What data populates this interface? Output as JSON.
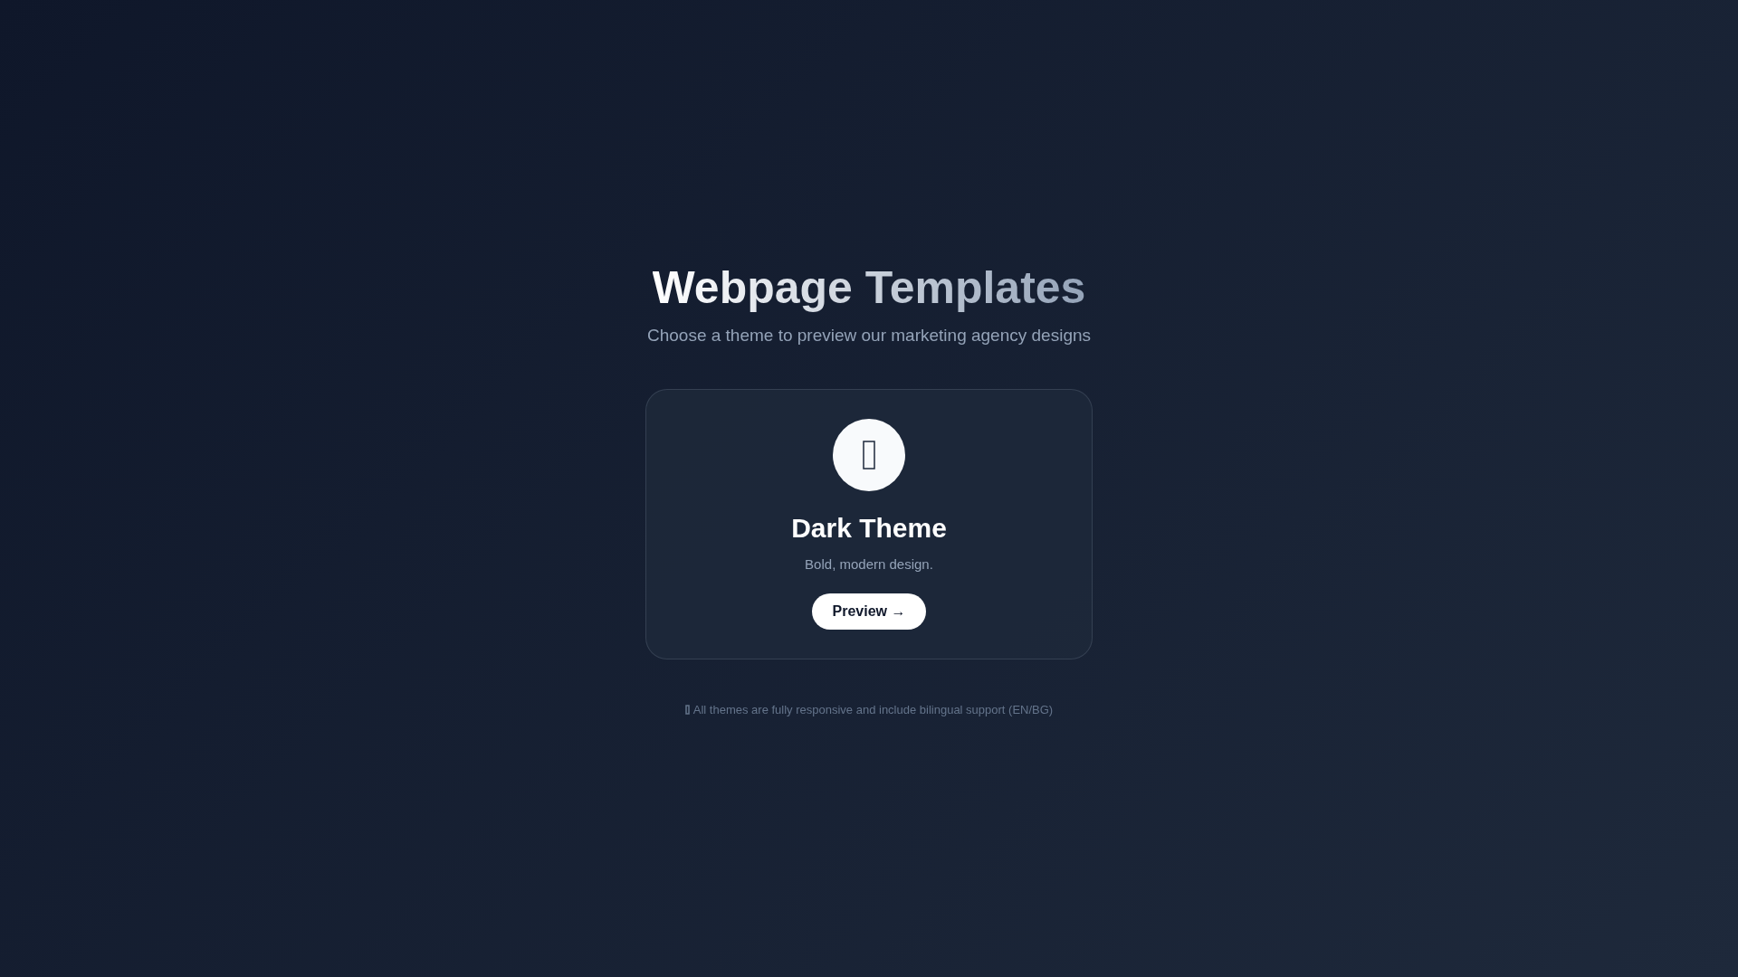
{
  "header": {
    "title": "Webpage Templates",
    "subtitle": "Choose a theme to preview our marketing agency designs"
  },
  "themes": [
    {
      "name": "Dark Theme",
      "description": "Bold, modern design.",
      "button": "Preview →"
    }
  ],
  "footer": {
    "note": "All themes are fully responsive and include bilingual support (EN/BG)"
  }
}
